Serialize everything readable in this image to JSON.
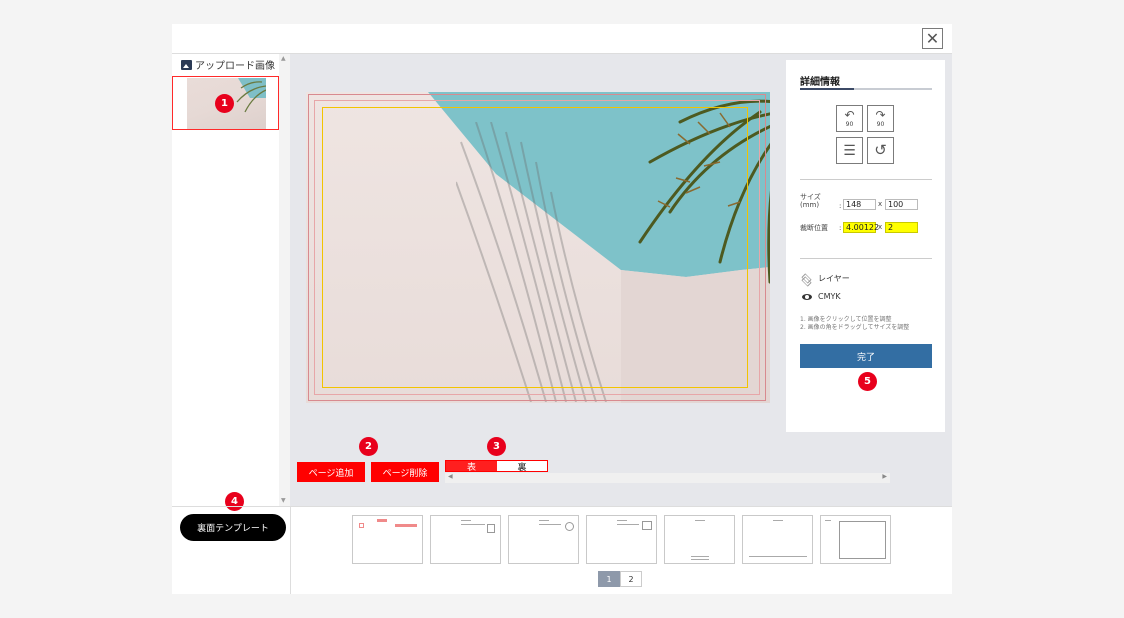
{
  "close_label": "✕",
  "sidebar": {
    "title": "アップロード画像",
    "scroll_up": "▲",
    "scroll_down": "▼"
  },
  "actions": {
    "add_page": "ページ追加",
    "delete_page": "ページ削除",
    "front": "表",
    "back": "裏",
    "scroll_left": "◀",
    "scroll_right": "▶"
  },
  "detail": {
    "title": "詳細情報",
    "rotate_left_label": "90",
    "rotate_right_label": "90",
    "size_label": "サイズ(mm)",
    "size_width": "148",
    "size_height": "100",
    "crop_label": "裁断位置",
    "crop_x": "4.00122",
    "crop_y": "2",
    "separator": "x",
    "colon": ":",
    "layer_label": "レイヤー",
    "color_mode": "CMYK",
    "hint_1": "1. 画像をクリックして位置を調整",
    "hint_2": "2. 画像の角をドラッグしてサイズを調整",
    "done_label": "完了"
  },
  "badges": [
    "1",
    "2",
    "3",
    "4",
    "5"
  ],
  "template_button": "裏面テンプレート",
  "pagination": {
    "pages": [
      "1",
      "2"
    ],
    "current": "1"
  },
  "colors": {
    "accent_red": "#ff0000",
    "badge_red": "#e8001c",
    "done_blue": "#336ea3",
    "highlight_yellow": "#ffff00",
    "sky": "#7ec2c9"
  }
}
